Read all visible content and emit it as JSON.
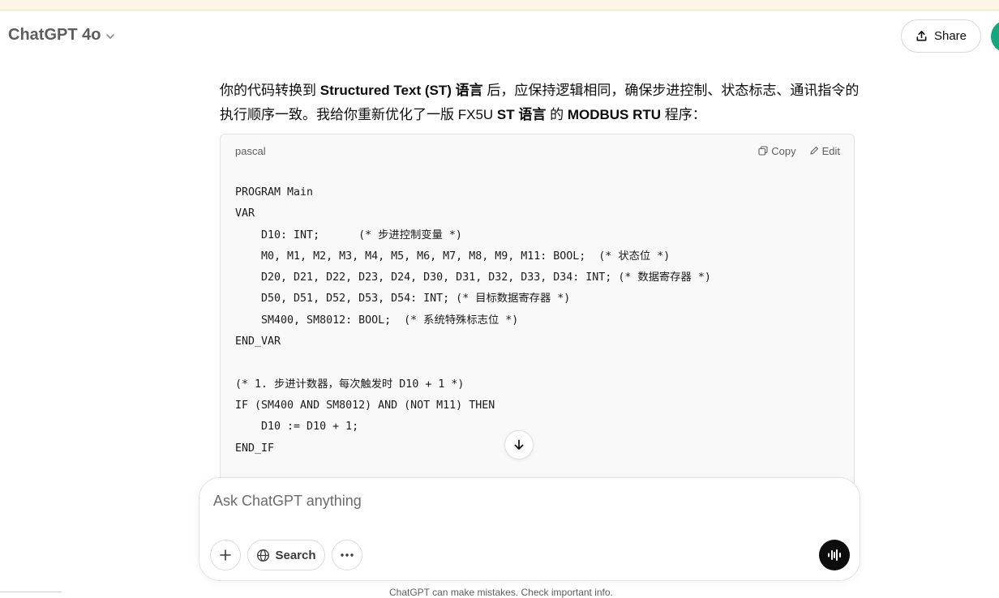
{
  "header": {
    "model_name": "ChatGPT 4o",
    "share_label": "Share"
  },
  "message": {
    "p1_a": "你的代码转换到 ",
    "p1_b": "Structured Text (ST) 语言",
    "p1_c": " 后，应保持逻辑相同，确保步进控制、状态标志、通讯指令的执行顺序一致。我给你重新优化了一版 FX5U ",
    "p1_d": "ST 语言",
    "p1_e": " 的 ",
    "p1_f": "MODBUS RTU",
    "p1_g": " 程序："
  },
  "code_block": {
    "language": "pascal",
    "copy_label": "Copy",
    "edit_label": "Edit",
    "lines": [
      "PROGRAM Main",
      "VAR",
      "    D10: INT;      (* 步进控制变量 *)",
      "    M0, M1, M2, M3, M4, M5, M6, M7, M8, M9, M11: BOOL;  (* 状态位 *)",
      "    D20, D21, D22, D23, D24, D30, D31, D32, D33, D34: INT; (* 数据寄存器 *)",
      "    D50, D51, D52, D53, D54: INT; (* 目标数据寄存器 *)",
      "    SM400, SM8012: BOOL;  (* 系统特殊标志位 *)",
      "END_VAR",
      "",
      "(* 1. 步进计数器，每次触发时 D10 + 1 *)",
      "IF (SM400 AND SM8012) AND (NOT M11) THEN",
      "    D10 := D10 + 1;",
      "END_IF"
    ]
  },
  "composer": {
    "placeholder": "Ask ChatGPT anything",
    "search_label": "Search"
  },
  "footer": {
    "note": "ChatGPT can make mistakes. Check important info."
  },
  "colors": {
    "banner": "#fdf5e6",
    "code_bg": "#f9f9f9",
    "avatar": "#19a37f",
    "voice_button": "#0d0d0d"
  }
}
